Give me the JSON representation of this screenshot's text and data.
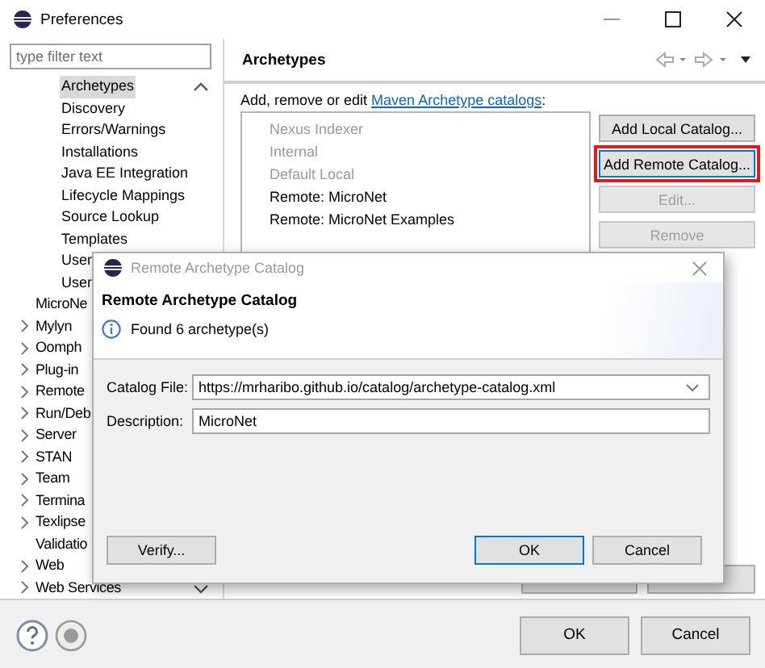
{
  "window": {
    "title": "Preferences"
  },
  "filter": {
    "placeholder": "type filter text"
  },
  "tree": {
    "nested_items": [
      {
        "label": "Archetypes",
        "selected": true
      },
      {
        "label": "Discovery",
        "selected": false
      },
      {
        "label": "Errors/Warnings",
        "selected": false
      },
      {
        "label": "Installations",
        "selected": false
      },
      {
        "label": "Java EE Integration",
        "selected": false
      },
      {
        "label": "Lifecycle Mappings",
        "selected": false
      },
      {
        "label": "Source Lookup",
        "selected": false
      },
      {
        "label": "Templates",
        "selected": false
      },
      {
        "label": "User",
        "selected": false
      },
      {
        "label": "User",
        "selected": false
      }
    ],
    "items": [
      {
        "label": "MicroNe",
        "expandable": false,
        "selected": false
      },
      {
        "label": "Mylyn",
        "expandable": true,
        "selected": false
      },
      {
        "label": "Oomph",
        "expandable": true,
        "selected": false
      },
      {
        "label": "Plug-in",
        "expandable": true,
        "selected": false
      },
      {
        "label": "Remote",
        "expandable": true,
        "selected": false
      },
      {
        "label": "Run/Deb",
        "expandable": true,
        "selected": false
      },
      {
        "label": "Server",
        "expandable": true,
        "selected": false
      },
      {
        "label": "STAN",
        "expandable": true,
        "selected": false
      },
      {
        "label": "Team",
        "expandable": true,
        "selected": false
      },
      {
        "label": "Termina",
        "expandable": true,
        "selected": false
      },
      {
        "label": "Texlipse",
        "expandable": true,
        "selected": false
      },
      {
        "label": "Validatio",
        "expandable": false,
        "selected": false
      },
      {
        "label": "Web",
        "expandable": true,
        "selected": false
      },
      {
        "label": "Web Services",
        "expandable": true,
        "selected": false
      }
    ]
  },
  "page": {
    "title": "Archetypes",
    "intro": {
      "text": "Add, remove or edit ",
      "link": "Maven Archetype catalogs",
      "suffix": ":"
    },
    "catalogs": [
      {
        "label": "Nexus Indexer",
        "enabled": false
      },
      {
        "label": "Internal",
        "enabled": false
      },
      {
        "label": "Default Local",
        "enabled": false
      },
      {
        "label": "Remote: MicroNet",
        "enabled": true
      },
      {
        "label": "Remote: MicroNet Examples",
        "enabled": true
      }
    ],
    "buttons": [
      {
        "label": "Add Local Catalog...",
        "disabled": false,
        "highlighted": false
      },
      {
        "label": "Add Remote Catalog...",
        "disabled": false,
        "highlighted": true
      },
      {
        "label": "Edit...",
        "disabled": true,
        "highlighted": false
      },
      {
        "label": "Remove",
        "disabled": true,
        "highlighted": false
      }
    ]
  },
  "dialog": {
    "title": "Remote Archetype Catalog",
    "heading": "Remote Archetype Catalog",
    "message": "Found 6 archetype(s)",
    "fields": [
      {
        "kind": "combo",
        "label": "Catalog File:",
        "value": "https://mrharibo.github.io/catalog/archetype-catalog.xml"
      },
      {
        "kind": "text",
        "label": "Description:",
        "value": "MicroNet"
      }
    ],
    "verify_button": "Verify...",
    "buttons": [
      {
        "label": "OK",
        "default": true
      },
      {
        "label": "Cancel",
        "default": false
      }
    ]
  },
  "footer_buttons": [
    "OK",
    "Cancel"
  ]
}
